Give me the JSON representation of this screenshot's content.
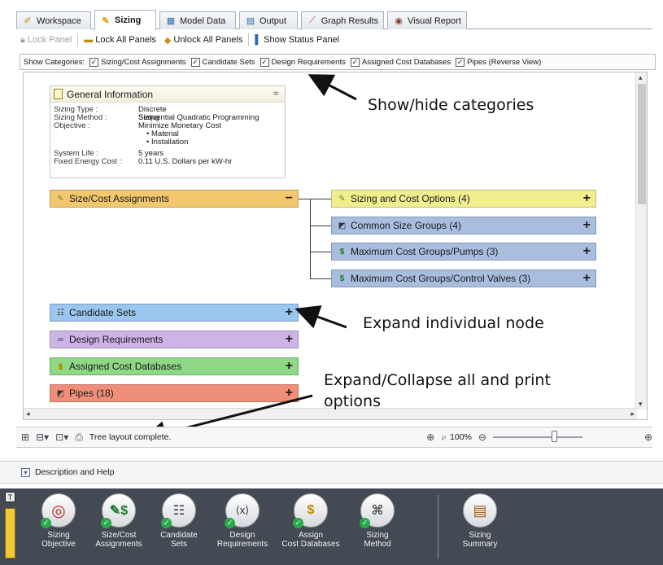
{
  "tabs": [
    {
      "label": "Workspace",
      "icon": "workspace-icon",
      "active": false
    },
    {
      "label": "Sizing",
      "icon": "sizing-pencil-icon",
      "active": true
    },
    {
      "label": "Model Data",
      "icon": "model-data-icon",
      "active": false
    },
    {
      "label": "Output",
      "icon": "output-table-icon",
      "active": false
    },
    {
      "label": "Graph Results",
      "icon": "graph-icon",
      "active": false
    },
    {
      "label": "Visual Report",
      "icon": "eye-icon",
      "active": false
    }
  ],
  "toolbar": {
    "lock_panel": "Lock Panel",
    "lock_all": "Lock All Panels",
    "unlock_all": "Unlock All Panels",
    "show_status": "Show Status Panel"
  },
  "categories": {
    "label": "Show Categories:",
    "items": [
      {
        "label": "Sizing/Cost Assignments",
        "checked": true
      },
      {
        "label": "Candidate Sets",
        "checked": true
      },
      {
        "label": "Design Requirements",
        "checked": true
      },
      {
        "label": "Assigned Cost Databases",
        "checked": true
      },
      {
        "label": "Pipes (Reverse View)",
        "checked": true
      }
    ]
  },
  "general_info": {
    "title": "General Information",
    "sizing_type_label": "Sizing Type :",
    "sizing_type": "Discrete Sizing",
    "sizing_method_label": "Sizing Method :",
    "sizing_method": "Sequential Quadratic Programming",
    "objective_label": "Objective :",
    "objective": "Minimize Monetary Cost",
    "objective_items": [
      "• Material",
      "• Installation"
    ],
    "system_life_label": "System Life :",
    "system_life": "5 years",
    "fixed_energy_label": "Fixed Energy Cost :",
    "fixed_energy": "0.11 U.S. Dollars per kW-hr"
  },
  "tree_nodes": {
    "size_cost": {
      "label": "Size/Cost Assignments",
      "toggle": "−",
      "color": "#f2c76e"
    },
    "children": [
      {
        "label": "Sizing and Cost Options (4)",
        "toggle": "+",
        "color": "#f0ee8e",
        "icon": "sizing-options-icon"
      },
      {
        "label": "Common Size Groups (4)",
        "toggle": "+",
        "color": "#a9bedf",
        "icon": "pipe-group-icon"
      },
      {
        "label": "Maximum Cost Groups/Pumps (3)",
        "toggle": "+",
        "color": "#a9bedf",
        "icon": "dollar-icon"
      },
      {
        "label": "Maximum Cost Groups/Control Valves (3)",
        "toggle": "+",
        "color": "#a9bedf",
        "icon": "dollar-icon"
      }
    ],
    "candidate_sets": {
      "label": "Candidate Sets",
      "toggle": "+",
      "color": "#9ac6ef"
    },
    "design_requirements": {
      "label": "Design Requirements",
      "toggle": "+",
      "color": "#cdb3e6"
    },
    "assigned_cost_db": {
      "label": "Assigned Cost Databases",
      "toggle": "+",
      "color": "#8fd886"
    },
    "pipes": {
      "label": "Pipes (18)",
      "toggle": "+",
      "color": "#ef8f7a"
    }
  },
  "annotations": {
    "show_hide": "Show/hide categories",
    "expand_node": "Expand individual node",
    "expand_collapse_line1": "Expand/Collapse all and print",
    "expand_collapse_line2": "options"
  },
  "status": {
    "text": "Tree layout complete.",
    "zoom": "100%",
    "zoom_fraction": 0.68
  },
  "description": {
    "label": "Description and Help"
  },
  "bottom_nav": [
    {
      "label": "Sizing\nObjective",
      "icon": "target-icon",
      "glyph": "◎",
      "checked": true
    },
    {
      "label": "Size/Cost\nAssignments",
      "icon": "size-cost-icon",
      "glyph": "$",
      "checked": true
    },
    {
      "label": "Candidate\nSets",
      "icon": "candidate-sets-icon",
      "glyph": "☰",
      "checked": true
    },
    {
      "label": "Design\nRequirements",
      "icon": "design-requirements-icon",
      "glyph": "⟨x⟩",
      "checked": true
    },
    {
      "label": "Assign\nCost Databases",
      "icon": "cost-database-icon",
      "glyph": "$",
      "checked": true
    },
    {
      "label": "Sizing\nMethod",
      "icon": "sizing-method-icon",
      "glyph": "⌘",
      "checked": true
    },
    {
      "label": "Sizing\nSummary",
      "icon": "clipboard-icon",
      "glyph": "▤",
      "checked": false
    }
  ]
}
